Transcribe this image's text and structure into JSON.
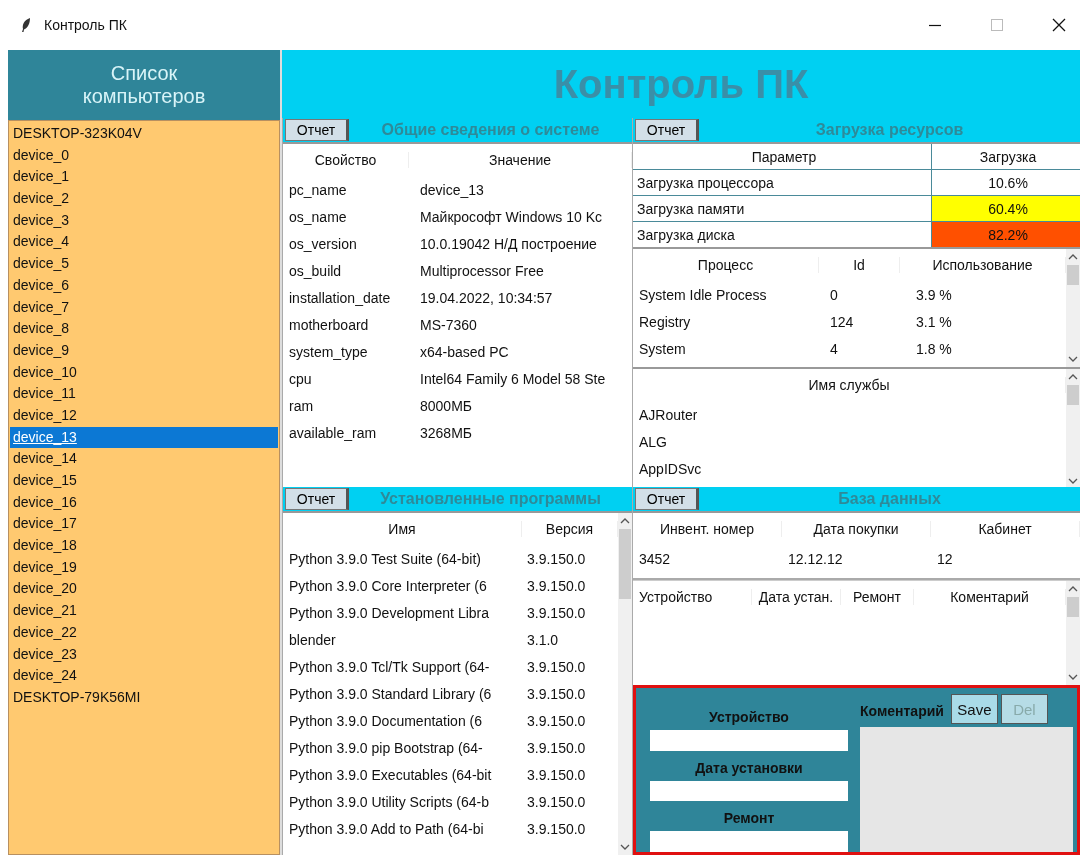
{
  "window": {
    "title": "Контроль ПК"
  },
  "sidebar": {
    "title": "Список компьютеров",
    "items": [
      {
        "label": "DESKTOP-323K04V",
        "selected": false
      },
      {
        "label": "device_0",
        "selected": false
      },
      {
        "label": "device_1",
        "selected": false
      },
      {
        "label": "device_2",
        "selected": false
      },
      {
        "label": "device_3",
        "selected": false
      },
      {
        "label": "device_4",
        "selected": false
      },
      {
        "label": "device_5",
        "selected": false
      },
      {
        "label": "device_6",
        "selected": false
      },
      {
        "label": "device_7",
        "selected": false
      },
      {
        "label": "device_8",
        "selected": false
      },
      {
        "label": "device_9",
        "selected": false
      },
      {
        "label": "device_10",
        "selected": false
      },
      {
        "label": "device_11",
        "selected": false
      },
      {
        "label": "device_12",
        "selected": false
      },
      {
        "label": "device_13",
        "selected": true
      },
      {
        "label": "device_14",
        "selected": false
      },
      {
        "label": "device_15",
        "selected": false
      },
      {
        "label": "device_16",
        "selected": false
      },
      {
        "label": "device_17",
        "selected": false
      },
      {
        "label": "device_18",
        "selected": false
      },
      {
        "label": "device_19",
        "selected": false
      },
      {
        "label": "device_20",
        "selected": false
      },
      {
        "label": "device_21",
        "selected": false
      },
      {
        "label": "device_22",
        "selected": false
      },
      {
        "label": "device_23",
        "selected": false
      },
      {
        "label": "device_24",
        "selected": false
      },
      {
        "label": "DESKTOP-79K56MI",
        "selected": false
      }
    ]
  },
  "header": {
    "title": "Контроль ПК"
  },
  "system_info": {
    "report_button": "Отчет",
    "title": "Общие сведения о системе",
    "columns": [
      "Свойство",
      "Значение"
    ],
    "rows": [
      [
        "pc_name",
        "device_13"
      ],
      [
        "os_name",
        "Майкрософт Windows 10 Kc"
      ],
      [
        "os_version",
        "10.0.19042 Н/Д построение"
      ],
      [
        "os_build",
        "Multiprocessor Free"
      ],
      [
        "installation_date",
        "19.04.2022, 10:34:57"
      ],
      [
        "motherboard",
        "MS-7360"
      ],
      [
        "system_type",
        "x64-based PC"
      ],
      [
        "cpu",
        "Intel64 Family 6 Model 58 Ste"
      ],
      [
        "ram",
        "8000МБ"
      ],
      [
        "available_ram",
        "3268МБ"
      ]
    ]
  },
  "resources": {
    "report_button": "Отчет",
    "title": "Загрузка ресурсов",
    "columns": [
      "Параметр",
      "Загрузка"
    ],
    "rows": [
      {
        "name": "Загрузка процессора",
        "value": "10.6%",
        "color": "#ffffff"
      },
      {
        "name": "Загрузка памяти",
        "value": "60.4%",
        "color": "#ffff00"
      },
      {
        "name": "Загрузка диска",
        "value": "82.2%",
        "color": "#ff5000"
      }
    ],
    "process_columns": [
      "Процесс",
      "Id",
      "Использование"
    ],
    "processes": [
      [
        "System Idle Process",
        "0",
        "3.9 %"
      ],
      [
        "Registry",
        "124",
        "3.1 %"
      ],
      [
        "System",
        "4",
        "1.8 %"
      ]
    ],
    "services_column": "Имя службы",
    "services": [
      "AJRouter",
      "ALG",
      "AppIDSvc"
    ]
  },
  "programs": {
    "report_button": "Отчет",
    "title": "Установленные программы",
    "columns": [
      "Имя",
      "Версия"
    ],
    "rows": [
      [
        "Python 3.9.0 Test Suite (64-bit)",
        "3.9.150.0"
      ],
      [
        "Python 3.9.0 Core Interpreter (6",
        "3.9.150.0"
      ],
      [
        "Python 3.9.0 Development Libra",
        "3.9.150.0"
      ],
      [
        "blender",
        "3.1.0"
      ],
      [
        "Python 3.9.0 Tcl/Tk Support (64-",
        "3.9.150.0"
      ],
      [
        "Python 3.9.0 Standard Library (6",
        "3.9.150.0"
      ],
      [
        "Python 3.9.0 Documentation (6",
        "3.9.150.0"
      ],
      [
        "Python 3.9.0 pip Bootstrap (64-",
        "3.9.150.0"
      ],
      [
        "Python 3.9.0 Executables (64-bit",
        "3.9.150.0"
      ],
      [
        "Python 3.9.0 Utility Scripts (64-b",
        "3.9.150.0"
      ],
      [
        "Python 3.9.0 Add to Path (64-bi",
        "3.9.150.0"
      ]
    ]
  },
  "database": {
    "report_button": "Отчет",
    "title": "База данных",
    "columns": [
      "Инвент. номер",
      "Дата покупки",
      "Кабинет"
    ],
    "row": [
      "3452",
      "12.12.12",
      "12"
    ],
    "device_columns": [
      "Устройство",
      "Дата устан.",
      "Ремонт",
      "Коментарий"
    ],
    "form": {
      "fields": [
        "Устройство",
        "Дата установки",
        "Ремонт"
      ],
      "comment_label": "Коментарий",
      "buttons": [
        {
          "label": "Save",
          "disabled": false
        },
        {
          "label": "Del",
          "disabled": true
        }
      ]
    }
  }
}
